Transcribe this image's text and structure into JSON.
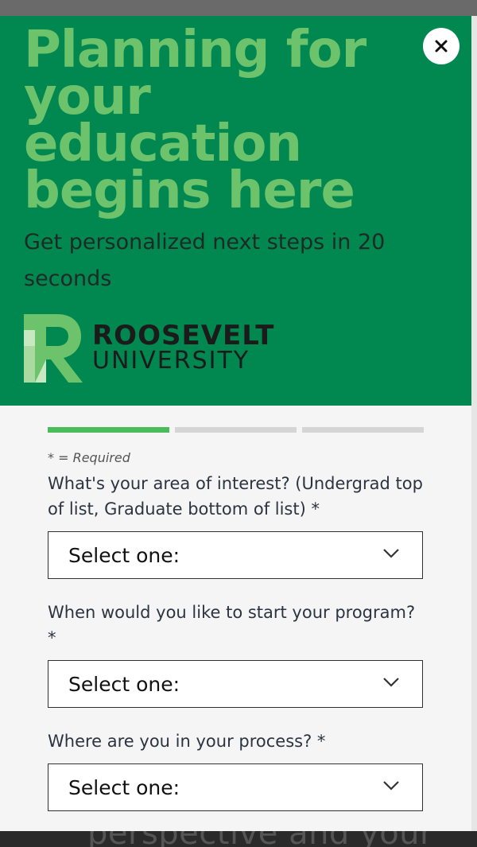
{
  "hero": {
    "headline_lines": [
      "Planning for",
      "your",
      "education",
      "begins here"
    ],
    "subheadline": "Get personalized next steps in 20 seconds",
    "close_label": "×",
    "brand_line1": "ROOSEVELT",
    "brand_line2": "UNIVERSITY"
  },
  "form": {
    "progress_steps": 3,
    "current_step": 1,
    "required_note": "* = Required",
    "fields": [
      {
        "label": "What's your area of interest? (Undergrad top of list, Graduate bottom of list) *",
        "selected": "Select one:"
      },
      {
        "label": "When would you like to start your program? *",
        "selected": "Select one:"
      },
      {
        "label": "Where are you in your process? *",
        "selected": "Select one:"
      }
    ]
  },
  "background": {
    "peek_text": "perspective and your"
  },
  "colors": {
    "hero_green": "#008850",
    "headline_green": "#6cc36b",
    "progress_active": "#4cbc5a",
    "progress_inactive": "#d5d5d5"
  },
  "icons": [
    "close-icon",
    "chevron-down-icon",
    "roosevelt-logo-mark"
  ]
}
